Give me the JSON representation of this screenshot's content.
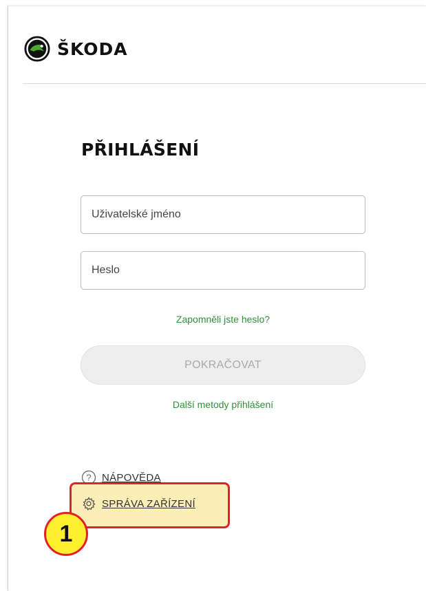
{
  "header": {
    "brand": "ŠKODA",
    "logo_icon": "skoda-winged-arrow-icon"
  },
  "login": {
    "title": "PŘIHLÁŠENÍ",
    "username_placeholder": "Uživatelské jméno",
    "password_placeholder": "Heslo",
    "forgot_password": "Zapomněli jste heslo?",
    "continue_label": "POKRAČOVAT",
    "other_methods": "Další metody přihlášení"
  },
  "footer_links": {
    "help_label": "NÁPOVĚDA",
    "help_icon": "question-circle-icon",
    "devices_label": "SPRÁVA ZAŘÍZENÍ",
    "devices_icon": "gear-icon"
  },
  "annotation": {
    "step_number": "1",
    "highlight_color": "#fbeeb7",
    "border_color": "#e5202a",
    "badge_color": "#ffef2e"
  },
  "colors": {
    "link_green": "#2f8f3a",
    "button_disabled_bg": "#eeeeee",
    "button_disabled_text": "#a9a9a9"
  }
}
